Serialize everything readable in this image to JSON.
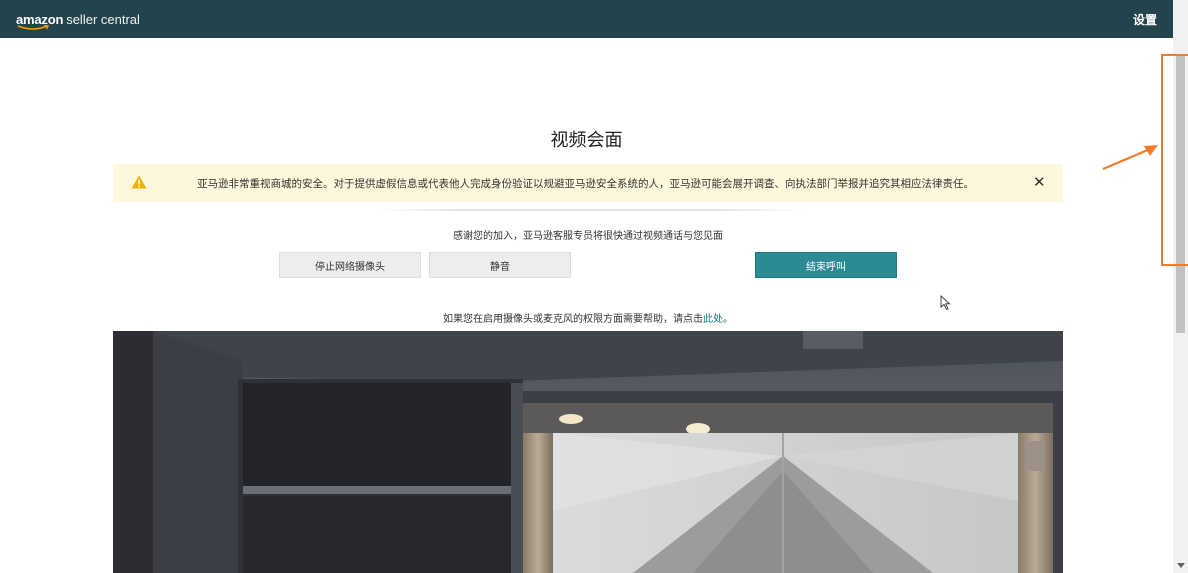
{
  "header": {
    "logo_brand": "amazon",
    "logo_product": "seller central",
    "settings_label": "设置"
  },
  "page": {
    "title": "视频会面"
  },
  "alert": {
    "message": "亚马逊非常重视商城的安全。对于提供虚假信息或代表他人完成身份验证以规避亚马逊安全系统的人，亚马逊可能会展开调查、向执法部门举报并追究其相应法律责任。",
    "close_glyph": "✕",
    "icon": "warning-icon"
  },
  "call": {
    "thanks_text": "感谢您的加入，亚马逊客服专员将很快通过视频通话与您见面",
    "stop_camera_label": "停止网络摄像头",
    "mute_label": "静音",
    "end_call_label": "结束呼叫"
  },
  "help": {
    "text_prefix": "如果您在启用摄像头或麦克风的权限方面需要帮助，请点击",
    "link_text": "此处",
    "text_suffix": "。"
  },
  "colors": {
    "header_bg": "#24444d",
    "alert_bg": "#fdf8db",
    "primary_button": "#2b8a94",
    "link": "#0a7c86",
    "annotation": "#f07c2c"
  }
}
